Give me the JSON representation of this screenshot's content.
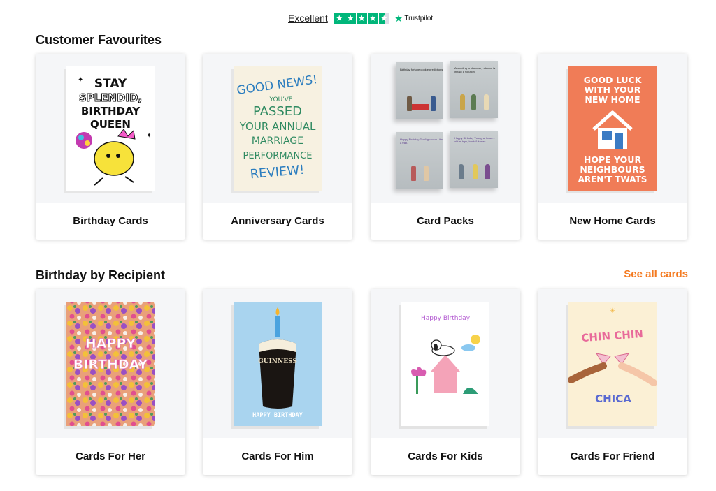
{
  "trustpilot": {
    "rating_text": "Excellent",
    "brand": "Trustpilot",
    "stars": 4.5,
    "brand_color": "#00b67a"
  },
  "sections": [
    {
      "title": "Customer Favourites",
      "cards": [
        {
          "label": "Birthday Cards",
          "art_text": [
            "STAY",
            "SPLENDID,",
            "BIRTHDAY",
            "QUEEN"
          ]
        },
        {
          "label": "Anniversary Cards",
          "art_text": [
            "GOOD NEWS!",
            "YOU'VE",
            "PASSED",
            "YOUR ANNUAL",
            "MARRIAGE",
            "PERFORMANCE",
            "REVIEW!"
          ]
        },
        {
          "label": "Card Packs",
          "art_text": [
            "Birthday fortune cookie predictions",
            "According to chemistry alcohol is in fact a solution",
            "Happy Birthday Don't grow up.. it's a trap.",
            "Happy Birthday Young at heart... old at hips, back & knees."
          ]
        },
        {
          "label": "New Home Cards",
          "art_text": [
            "GOOD LUCK",
            "WITH YOUR",
            "NEW HOME",
            "HOPE YOUR",
            "NEIGHBOURS",
            "AREN'T TWATS"
          ]
        }
      ]
    },
    {
      "title": "Birthday by Recipient",
      "link": "See all cards",
      "cards": [
        {
          "label": "Cards For Her",
          "art_text": [
            "HAPPY",
            "BIRTHDAY"
          ]
        },
        {
          "label": "Cards For Him",
          "art_text": [
            "GUINNESS",
            "HAPPY BIRTHDAY"
          ]
        },
        {
          "label": "Cards For Kids",
          "art_text": [
            "Happy Birthday"
          ]
        },
        {
          "label": "Cards For Friend",
          "art_text": [
            "CHIN CHIN",
            "CHICA"
          ]
        }
      ]
    }
  ],
  "colors": {
    "accent": "#f47a20"
  }
}
